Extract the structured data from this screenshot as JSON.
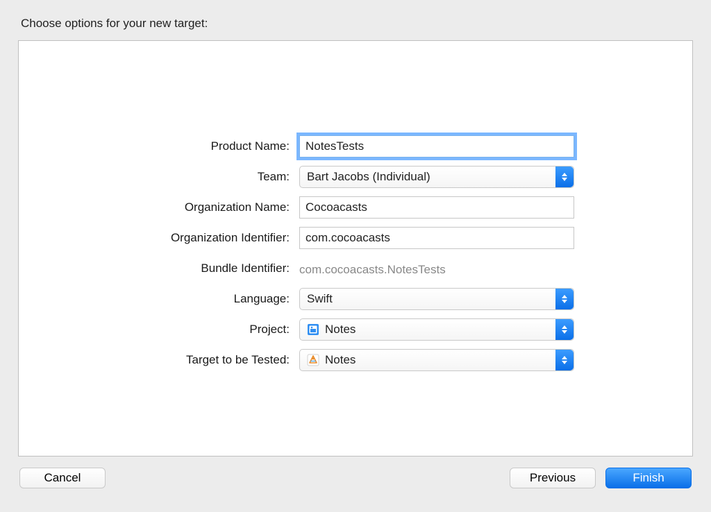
{
  "heading": "Choose options for your new target:",
  "form": {
    "product_name": {
      "label": "Product Name:",
      "value": "NotesTests"
    },
    "team": {
      "label": "Team:",
      "value": "Bart Jacobs (Individual)"
    },
    "org_name": {
      "label": "Organization Name:",
      "value": "Cocoacasts"
    },
    "org_identifier": {
      "label": "Organization Identifier:",
      "value": "com.cocoacasts"
    },
    "bundle_identifier": {
      "label": "Bundle Identifier:",
      "value": "com.cocoacasts.NotesTests"
    },
    "language": {
      "label": "Language:",
      "value": "Swift"
    },
    "project": {
      "label": "Project:",
      "value": "Notes"
    },
    "target_to_test": {
      "label": "Target to be Tested:",
      "value": "Notes"
    }
  },
  "buttons": {
    "cancel": "Cancel",
    "previous": "Previous",
    "finish": "Finish"
  }
}
